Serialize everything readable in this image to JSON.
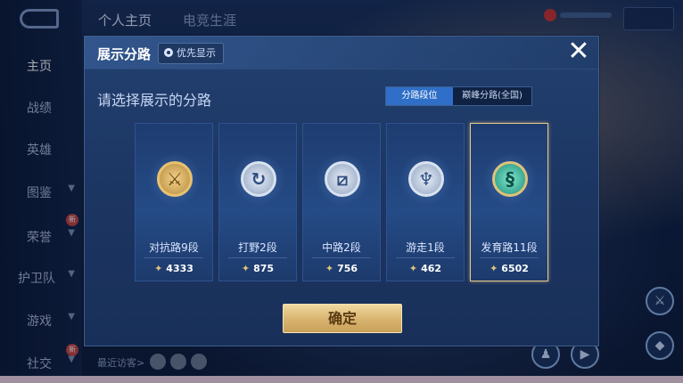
{
  "top_nav": {
    "profile_tab": "个人主页",
    "career_tab": "电竞生涯"
  },
  "sidebar": {
    "items": [
      {
        "label": "主页",
        "active": true
      },
      {
        "label": "战绩"
      },
      {
        "label": "英雄"
      },
      {
        "label": "图鉴"
      },
      {
        "label": "荣誉"
      },
      {
        "label": "护卫队"
      },
      {
        "label": "游戏"
      },
      {
        "label": "社交"
      }
    ]
  },
  "footer": {
    "recent_visitors": "最近访客>"
  },
  "dialog": {
    "title": "展示分路",
    "priority_button": "优先显示",
    "prompt": "请选择展示的分路",
    "toggle": {
      "active": "分路段位",
      "inactive": "巅峰分路(全国)"
    },
    "cards": [
      {
        "label": "对抗路9段",
        "score": "4333",
        "icon": "sword-emblem-icon",
        "selected": false
      },
      {
        "label": "打野2段",
        "score": "875",
        "icon": "jungle-emblem-icon",
        "selected": false
      },
      {
        "label": "中路2段",
        "score": "756",
        "icon": "mid-emblem-icon",
        "selected": false
      },
      {
        "label": "游走1段",
        "score": "462",
        "icon": "roam-emblem-icon",
        "selected": false
      },
      {
        "label": "发育路11段",
        "score": "6502",
        "icon": "farm-emblem-icon",
        "selected": true
      }
    ],
    "confirm_label": "确定"
  },
  "colors": {
    "accent_blue": "#2f6fc8",
    "gold": "#e3c37a",
    "selected_border": "#e6c98a"
  }
}
